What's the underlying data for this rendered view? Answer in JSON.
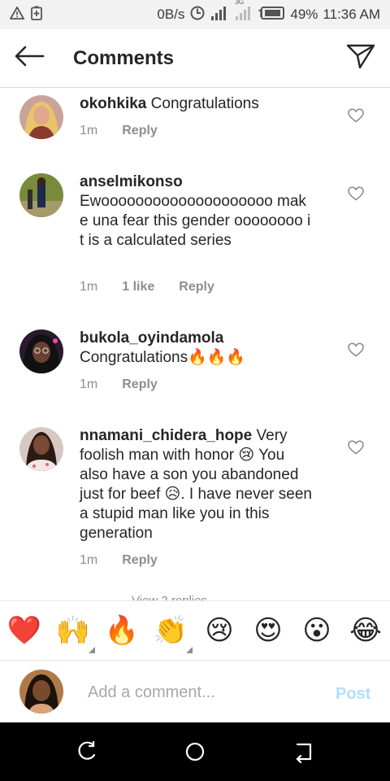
{
  "status_bar": {
    "net_speed": "0B/s",
    "battery_pct": "49%",
    "time": "11:36 AM",
    "net_type": "3G"
  },
  "header": {
    "title": "Comments",
    "back_icon": "arrow-left-icon",
    "send_icon": "paper-plane-icon"
  },
  "comments": [
    {
      "username": "okohkika",
      "text": "Congratulations",
      "time": "1m",
      "likes": "",
      "reply_label": "Reply"
    },
    {
      "username": "anselmikonso",
      "text": "Ewoooooooooooooooooooo make una fear this gender oooooooo it is a calculated series",
      "time": "1m",
      "likes": "1 like",
      "reply_label": "Reply"
    },
    {
      "username": "bukola_oyindamola",
      "text": "Congratulations🔥🔥🔥",
      "time": "1m",
      "likes": "",
      "reply_label": "Reply"
    },
    {
      "username": "nnamani_chidera_hope",
      "text": "Very foolish man with honor 😢 You also have a son you abandoned just for beef 😥. I have never seen a stupid man like you in this generation",
      "time": "1m",
      "likes": "",
      "reply_label": "Reply"
    }
  ],
  "view_replies": "View 2 replies",
  "emoji_bar": [
    "❤️",
    "🙌",
    "🔥",
    "👏",
    "😢",
    "😍",
    "😮",
    "😂"
  ],
  "add_comment": {
    "placeholder": "Add a comment...",
    "post_label": "Post"
  },
  "colors": {
    "username": "#262626",
    "meta": "#8e8e8e",
    "post_disabled": "#b2dffc"
  }
}
